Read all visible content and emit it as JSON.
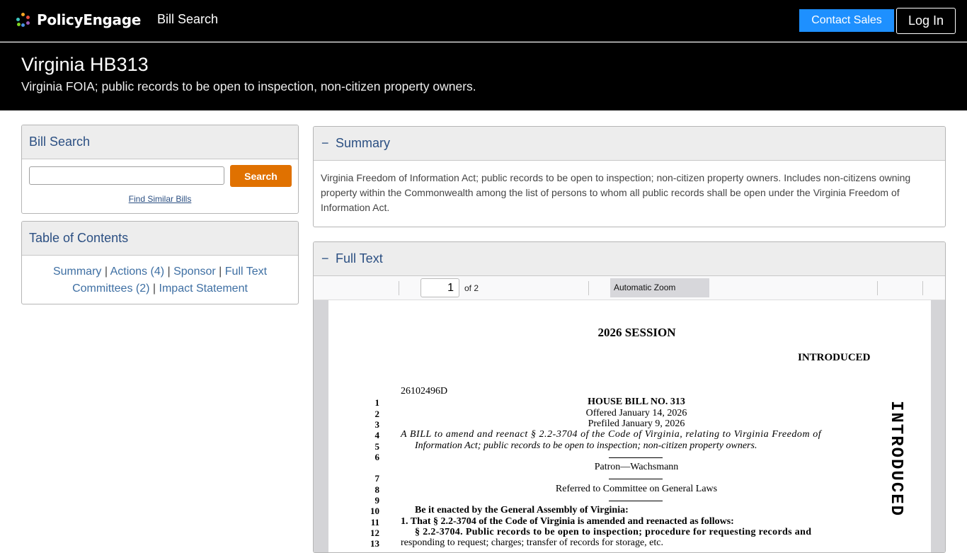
{
  "nav": {
    "brand": "PolicyEngage",
    "bill_search_link": "Bill Search",
    "contact_sales": "Contact Sales",
    "login": "Log In"
  },
  "hero": {
    "title": "Virginia HB313",
    "subtitle": "Virginia FOIA; public records to be open to inspection, non-citizen property owners."
  },
  "bill_search": {
    "heading": "Bill Search",
    "input_value": "",
    "search_button": "Search",
    "similar_link": "Find Similar Bills"
  },
  "toc": {
    "heading": "Table of Contents",
    "items": [
      "Summary",
      "Actions (4)",
      "Sponsor",
      "Full Text",
      "Committees (2)",
      "Impact Statement"
    ],
    "separator": "|"
  },
  "summary": {
    "toggle": "−",
    "heading": "Summary",
    "text": "Virginia Freedom of Information Act; public records to be open to inspection; non-citizen property owners. Includes non-citizens owning property within the Commonwealth among the list of persons to whom all public records shall be open under the Virginia Freedom of Information Act."
  },
  "full_text": {
    "toggle": "−",
    "heading": "Full Text",
    "toolbar": {
      "page_number": "1",
      "page_count": "of 2",
      "zoom": "Automatic Zoom"
    },
    "document": {
      "session": "2026 SESSION",
      "status": "INTRODUCED",
      "doc_number": "26102496D",
      "side_label": "INTRODUCED",
      "line_numbers": [
        "1",
        "2",
        "3",
        "4",
        "5",
        "6",
        "7",
        "8",
        "9",
        "10",
        "11",
        "12",
        "13"
      ],
      "lines": {
        "l1": "HOUSE BILL NO. 313",
        "l2": "Offered January 14, 2026",
        "l3": "Prefiled January 9, 2026",
        "l4": "A BILL to amend and reenact § 2.2-3704 of the Code of Virginia, relating to Virginia Freedom of",
        "l5": "Information Act; public records to be open to inspection; non-citizen property owners.",
        "l6": "Patron—Wachsmann",
        "l8": "Referred to Committee on General Laws",
        "l10": "Be it enacted by the General Assembly of Virginia:",
        "l11": "1. That § 2.2-3704 of the Code of Virginia is amended and reenacted as follows:",
        "l12": "§ 2.2-3704. Public records to be open to inspection; procedure for requesting records and",
        "l13": "responding to request; charges; transfer of records for storage, etc."
      }
    }
  },
  "colors": {
    "nav_bg": "#000000",
    "accent_blue": "#1e90ff",
    "search_orange": "#e07100",
    "link_blue": "#2b4f82"
  }
}
